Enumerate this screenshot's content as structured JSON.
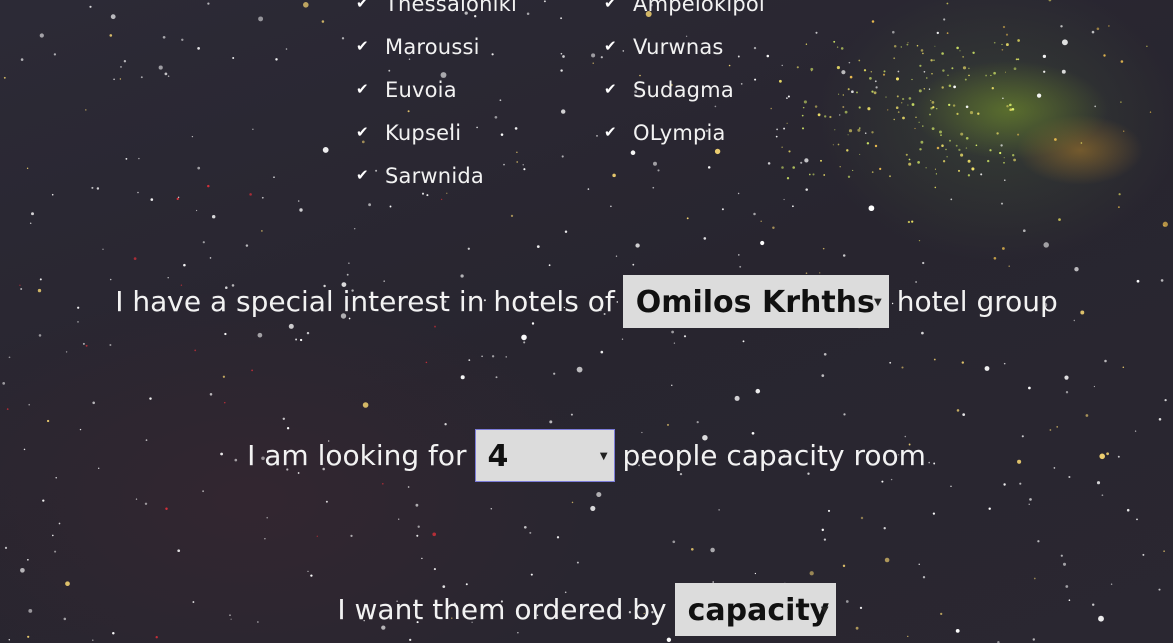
{
  "cities": {
    "left": [
      "Thessaloniki",
      "Maroussi",
      "Euvoia",
      "Kupseli",
      "Sarwnida"
    ],
    "right": [
      "Ampelokipoi",
      "Vurwnas",
      "Sudagma",
      "OLympia"
    ],
    "check_icon": "checkmark-icon"
  },
  "hotel_group": {
    "prefix": "I have a special interest in hotels of",
    "selected": "Omilos Krhths",
    "suffix": "hotel group"
  },
  "capacity": {
    "prefix": "I am looking for",
    "selected": "4",
    "suffix": "people capacity room"
  },
  "ordering": {
    "prefix": "I want them ordered by",
    "selected": "capacity"
  },
  "colors": {
    "background": "#27242f",
    "select_bg": "#dcdcdc",
    "focus_border": "#7c7cd8",
    "text": "#f2f2f2"
  }
}
